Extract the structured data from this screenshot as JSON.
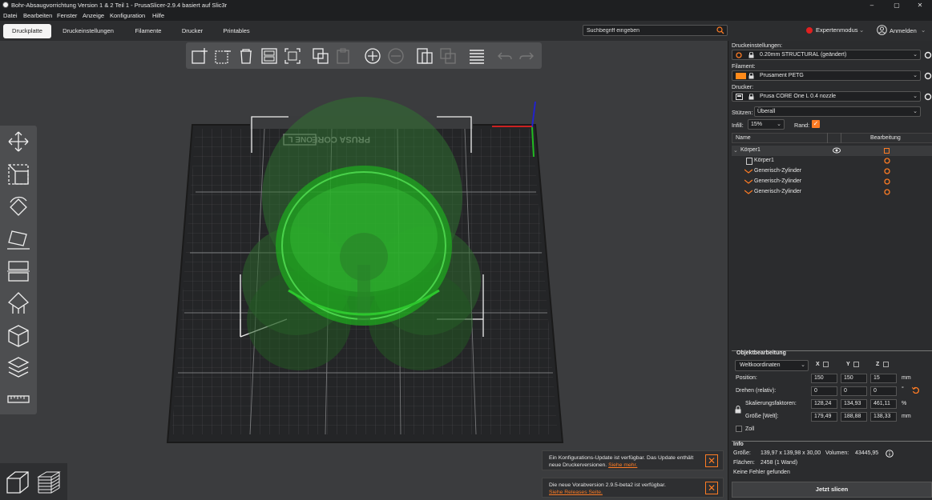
{
  "window": {
    "title": "Bohr-Absaugvorrichtung Version 1 & 2 Teil 1 - PrusaSlicer-2.9.4 basiert auf Slic3r",
    "minimize": "–",
    "maximize": "▢",
    "close": "✕"
  },
  "menu": [
    "Datei",
    "Bearbeiten",
    "Fenster",
    "Anzeige",
    "Konfiguration",
    "Hilfe"
  ],
  "tabs": [
    "Druckplatte",
    "Druckeinstellungen",
    "Filamente",
    "Drucker",
    "Printables"
  ],
  "search": {
    "placeholder": "Suchbegriff eingeben"
  },
  "mode": {
    "label": "Expertenmodus",
    "color": "#e02020"
  },
  "account": {
    "label": "Anmelden"
  },
  "colors": {
    "accent": "#ff7c24",
    "model_green": "#1fae1f",
    "bed": "#2a2b2d"
  },
  "bed_logo": {
    "brand_text": "PRUSA CORE",
    "boxed_text": "ONE L"
  },
  "sidebar": {
    "print_settings_label": "Druckeinstellungen:",
    "print_settings_value": "0.20mm STRUCTURAL (geändert)",
    "filament_label": "Filament:",
    "filament_value": "Prusament PETG",
    "filament_color": "#ff8a1a",
    "printer_label": "Drucker:",
    "printer_value": "Prusa CORE One L 0.4 nozzle",
    "supports_label": "Stützen:",
    "supports_value": "Überall",
    "infill_label": "Infill:",
    "infill_value": "15%",
    "brim_label": "Rand:",
    "brim_checked": true
  },
  "object_list": {
    "col_name": "Name",
    "col_edit": "Bearbeitung",
    "items": [
      "Körper1",
      "Körper1",
      "Generisch-Zylinder",
      "Generisch-Zylinder",
      "Generisch-Zylinder"
    ]
  },
  "object_edit": {
    "title": "Objektbearbeitung",
    "coord_system": "Weltkoordinaten",
    "axis_x": "X",
    "axis_y": "Y",
    "axis_z": "Z",
    "position_label": "Position:",
    "position": [
      "150",
      "150",
      "15"
    ],
    "position_unit": "mm",
    "rotate_label": "Drehen (relativ):",
    "rotate": [
      "0",
      "0",
      "0"
    ],
    "rotate_unit": "°",
    "scale_label": "Skalierungsfaktoren:",
    "scale": [
      "128,24",
      "134,93",
      "461,11"
    ],
    "scale_unit": "%",
    "size_label": "Größe [Welt]:",
    "size": [
      "179,49",
      "188,88",
      "138,33"
    ],
    "size_unit": "mm",
    "inch_label": "Zoll"
  },
  "info": {
    "title": "Info",
    "size_label": "Größe:",
    "size_value": "139,97 x 139,98 x 30,00",
    "volume_label": "Volumen:",
    "volume_value": "43445,95",
    "facets_label": "Flächen:",
    "facets_value": "2458 (1 Wand)",
    "errors": "Keine Fehler gefunden"
  },
  "slice_button": "Jetzt slicen",
  "notifications": [
    {
      "text": "Ein Konfigurations-Update ist verfügbar. Das Update enthält neue Druckerversionen.",
      "link": "Siehe mehr."
    },
    {
      "text": "Die neue Vorabversion 2.9.5-beta2 ist verfügbar.",
      "link": "Siehe Releases Seite."
    }
  ]
}
